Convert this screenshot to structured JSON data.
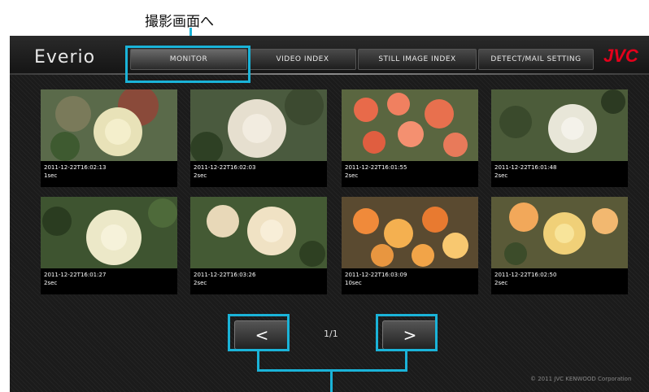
{
  "annotation": {
    "top_label": "撮影画面へ"
  },
  "header": {
    "logo": "Everio",
    "brand": "JVC",
    "tabs": [
      {
        "label": "MONITOR"
      },
      {
        "label": "VIDEO INDEX"
      },
      {
        "label": "STILL IMAGE INDEX"
      },
      {
        "label": "DETECT/MAIL SETTING"
      }
    ]
  },
  "thumbnails": [
    {
      "date": "2011-12-22T16:02:13",
      "duration": "1sec"
    },
    {
      "date": "2011-12-22T16:02:03",
      "duration": "2sec"
    },
    {
      "date": "2011-12-22T16:01:55",
      "duration": "2sec"
    },
    {
      "date": "2011-12-22T16:01:48",
      "duration": "2sec"
    },
    {
      "date": "2011-12-22T16:01:27",
      "duration": "2sec"
    },
    {
      "date": "2011-12-22T16:03:26",
      "duration": "2sec"
    },
    {
      "date": "2011-12-22T16:03:09",
      "duration": "10sec"
    },
    {
      "date": "2011-12-22T16:02:50",
      "duration": "2sec"
    }
  ],
  "pagination": {
    "prev": "<",
    "next": ">",
    "page": "1/1"
  },
  "footer": {
    "copyright": "© 2011 JVC KENWOOD Corporation"
  },
  "colors": {
    "highlight": "#1ab3d8",
    "brand": "#e4001b"
  }
}
